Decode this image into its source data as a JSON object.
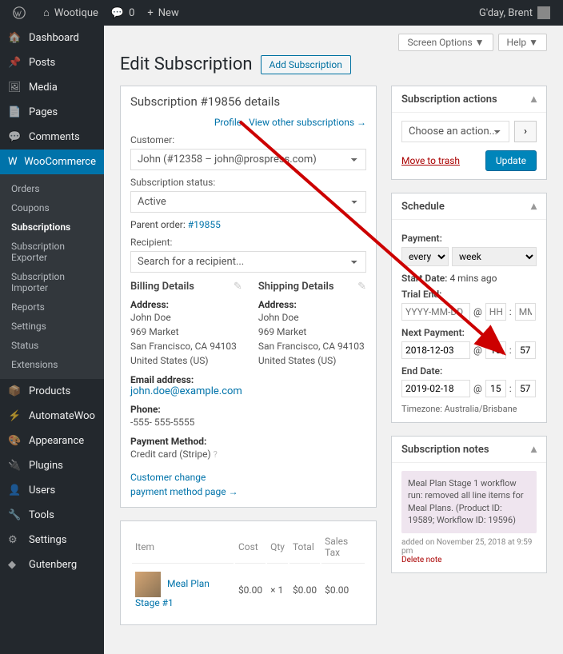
{
  "topbar": {
    "site_name": "Wootique",
    "comments_count": "0",
    "new_label": "New",
    "howdy": "G'day, Brent"
  },
  "sidebar": {
    "items": [
      {
        "label": "Dashboard"
      },
      {
        "label": "Posts"
      },
      {
        "label": "Media"
      },
      {
        "label": "Pages"
      },
      {
        "label": "Comments"
      },
      {
        "label": "WooCommerce"
      },
      {
        "label": "Products"
      },
      {
        "label": "AutomateWoo"
      },
      {
        "label": "Appearance"
      },
      {
        "label": "Plugins"
      },
      {
        "label": "Users"
      },
      {
        "label": "Tools"
      },
      {
        "label": "Settings"
      },
      {
        "label": "Gutenberg"
      }
    ],
    "woo_sub": [
      "Orders",
      "Coupons",
      "Subscriptions",
      "Subscription Exporter",
      "Subscription Importer",
      "Reports",
      "Settings",
      "Status",
      "Extensions"
    ]
  },
  "screen": {
    "options": "Screen Options",
    "help": "Help"
  },
  "page": {
    "title": "Edit Subscription",
    "add_btn": "Add Subscription"
  },
  "details": {
    "heading": "Subscription #19856 details",
    "customer_label": "Customer:",
    "profile_link": "Profile",
    "view_other": "View other subscriptions",
    "customer_value": "John (#12358 – john@prospress.com)",
    "status_label": "Subscription status:",
    "status_value": "Active",
    "parent_label": "Parent order:",
    "parent_link": "#19855",
    "recipient_label": "Recipient:",
    "recipient_placeholder": "Search for a recipient...",
    "billing": {
      "title": "Billing Details",
      "address_label": "Address:",
      "name": "John Doe",
      "line1": "969 Market",
      "city": "San Francisco, CA 94103",
      "country": "United States (US)",
      "email_label": "Email address:",
      "email": "john.doe@example.com",
      "phone_label": "Phone:",
      "phone": "-555- 555-5555",
      "paymethod_label": "Payment Method:",
      "paymethod": "Credit card (Stripe)",
      "paylink": "Customer change payment method page"
    },
    "shipping": {
      "title": "Shipping Details",
      "address_label": "Address:",
      "name": "John Doe",
      "line1": "969 Market",
      "city": "San Francisco, CA 94103",
      "country": "United States (US)"
    }
  },
  "actions": {
    "title": "Subscription actions",
    "placeholder": "Choose an action...",
    "trash": "Move to trash",
    "update": "Update"
  },
  "schedule": {
    "title": "Schedule",
    "payment_label": "Payment:",
    "every": "every",
    "unit": "week",
    "start_label": "Start Date:",
    "start_value": "4 mins ago",
    "trial_label": "Trial End:",
    "trial_date": "YYYY-MM-DD",
    "trial_hh": "HH",
    "trial_mm": "MM",
    "next_label": "Next Payment:",
    "next_date": "2018-12-03",
    "next_hh": "15",
    "next_mm": "57",
    "end_label": "End Date:",
    "end_date": "2019-02-18",
    "end_hh": "15",
    "end_mm": "57",
    "tz": "Timezone: Australia/Brisbane"
  },
  "notes": {
    "title": "Subscription notes",
    "text": "Meal Plan Stage 1 workflow run: removed all line items for Meal Plans. (Product ID: 19589; Workflow ID: 19596)",
    "meta": "added on November 25, 2018 at 9:59 pm",
    "delete": "Delete note"
  },
  "items": {
    "cols": {
      "item": "Item",
      "cost": "Cost",
      "qty": "Qty",
      "total": "Total",
      "tax": "Sales Tax"
    },
    "row": {
      "name": "Meal Plan Stage #1",
      "cost": "$0.00",
      "qty": "× 1",
      "total": "$0.00",
      "tax": "$0.00"
    }
  }
}
